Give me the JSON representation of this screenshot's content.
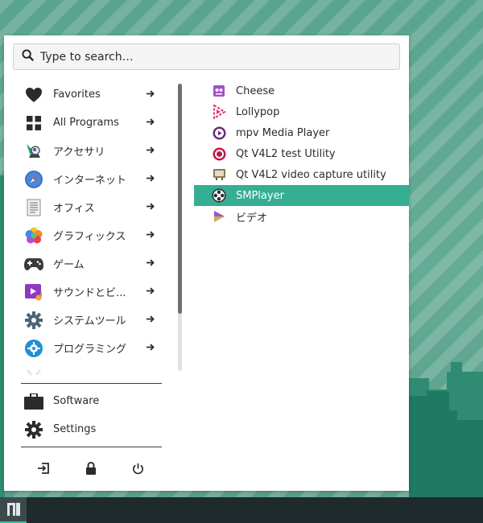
{
  "search": {
    "placeholder": "Type to search…"
  },
  "categories": [
    {
      "label": "Favorites",
      "icon": "heart-icon"
    },
    {
      "label": "All Programs",
      "icon": "grid-icon"
    },
    {
      "label": "アクセサリ",
      "icon": "accessories-icon"
    },
    {
      "label": "インターネット",
      "icon": "compass-icon"
    },
    {
      "label": "オフィス",
      "icon": "document-icon"
    },
    {
      "label": "グラフィックス",
      "icon": "graphics-icon"
    },
    {
      "label": "ゲーム",
      "icon": "gamepad-icon"
    },
    {
      "label": "サウンドとビ...",
      "icon": "multimedia-icon"
    },
    {
      "label": "システムツール",
      "icon": "system-gear-icon"
    },
    {
      "label": "プログラミング",
      "icon": "programming-icon"
    }
  ],
  "bottom": {
    "software": "Software",
    "settings": "Settings"
  },
  "apps": [
    {
      "label": "Cheese",
      "icon": "cheese-icon",
      "selected": false
    },
    {
      "label": "Lollypop",
      "icon": "lollypop-icon",
      "selected": false
    },
    {
      "label": "mpv Media Player",
      "icon": "mpv-icon",
      "selected": false
    },
    {
      "label": "Qt V4L2 test Utility",
      "icon": "qv4l2-icon",
      "selected": false
    },
    {
      "label": "Qt V4L2 video capture utility",
      "icon": "tv-icon",
      "selected": false
    },
    {
      "label": "SMPlayer",
      "icon": "film-reel-icon",
      "selected": true
    },
    {
      "label": "ビデオ",
      "icon": "video-play-icon",
      "selected": false
    }
  ],
  "colors": {
    "accent": "#35ae93",
    "wallpaper": "#5aa48e",
    "taskbar": "#1f2a2c"
  }
}
